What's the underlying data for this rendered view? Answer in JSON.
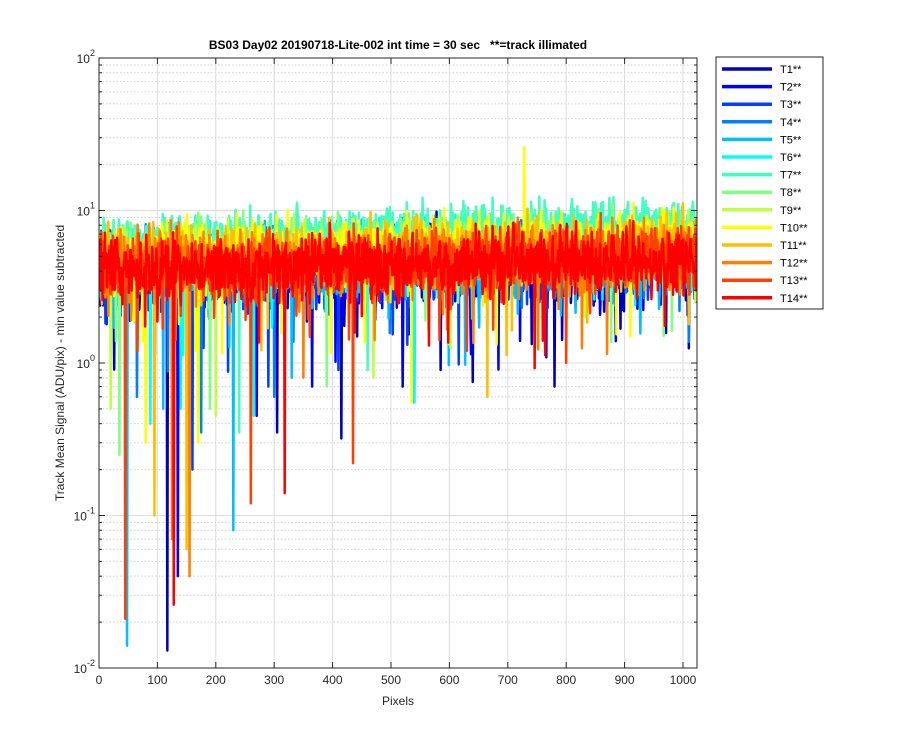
{
  "chart_data": {
    "type": "line",
    "title": "BS03 Day02 20190718-Lite-002 int time = 30 sec   **=track illimated",
    "xlabel": "Pixels",
    "ylabel": "Track Mean Signal (ADU/pix) - min value subtracted",
    "xlim": [
      0,
      1024
    ],
    "ylim": [
      0.01,
      100
    ],
    "yscale": "log",
    "grid": true,
    "legend_position": "outside-right",
    "x_ticks": [
      0,
      100,
      200,
      300,
      400,
      500,
      600,
      700,
      800,
      900,
      1000
    ],
    "y_ticks": [
      {
        "value": 0.01,
        "base": "10",
        "exp": "-2"
      },
      {
        "value": 0.1,
        "base": "10",
        "exp": "-1"
      },
      {
        "value": 1,
        "base": "10",
        "exp": "0"
      },
      {
        "value": 10,
        "base": "10",
        "exp": "1"
      },
      {
        "value": 100,
        "base": "10",
        "exp": "2"
      }
    ],
    "series": [
      {
        "name": "T1**",
        "color": "#0000bf",
        "level_start": 3.8,
        "level_end": 4.6,
        "noise": 0.28,
        "dips": [
          [
            117,
            0.013
          ],
          [
            305,
            0.35
          ],
          [
            415,
            0.32
          ],
          [
            520,
            0.7
          ],
          [
            585,
            0.9
          ],
          [
            640,
            0.75
          ],
          [
            780,
            0.7
          ]
        ]
      },
      {
        "name": "T2**",
        "color": "#0000ff",
        "level_start": 3.9,
        "level_end": 4.7,
        "noise": 0.27,
        "dips": [
          [
            135,
            0.04
          ],
          [
            270,
            0.45
          ],
          [
            365,
            0.7
          ],
          [
            520,
            0.8
          ]
        ]
      },
      {
        "name": "T3**",
        "color": "#0040ff",
        "level_start": 4.0,
        "level_end": 4.8,
        "noise": 0.26,
        "dips": [
          [
            160,
            0.2
          ],
          [
            290,
            0.7
          ],
          [
            410,
            0.9
          ]
        ]
      },
      {
        "name": "T4**",
        "color": "#0080ff",
        "level_start": 4.1,
        "level_end": 4.9,
        "noise": 0.26,
        "dips": [
          [
            65,
            0.6
          ],
          [
            175,
            0.35
          ],
          [
            300,
            0.6
          ],
          [
            540,
            0.55
          ]
        ]
      },
      {
        "name": "T5**",
        "color": "#00bfff",
        "level_start": 4.3,
        "level_end": 5.1,
        "noise": 0.25,
        "dips": [
          [
            48,
            0.014
          ],
          [
            110,
            0.5
          ],
          [
            230,
            0.08
          ],
          [
            330,
            0.8
          ]
        ]
      },
      {
        "name": "T6**",
        "color": "#00ffff",
        "level_start": 4.6,
        "level_end": 5.4,
        "noise": 0.25,
        "dips": [
          [
            88,
            0.4
          ],
          [
            140,
            0.5
          ],
          [
            265,
            0.45
          ],
          [
            540,
            0.55
          ]
        ]
      },
      {
        "name": "T7**",
        "color": "#40ffbf",
        "level_start": 6.3,
        "level_end": 8.5,
        "noise": 0.18,
        "dips": [
          [
            240,
            0.35
          ],
          [
            460,
            0.9
          ]
        ]
      },
      {
        "name": "T8**",
        "color": "#80ff80",
        "level_start": 5.0,
        "level_end": 6.2,
        "noise": 0.22,
        "dips": [
          [
            35,
            0.25
          ],
          [
            190,
            0.5
          ],
          [
            390,
            0.7
          ]
        ]
      },
      {
        "name": "T9**",
        "color": "#bfff40",
        "level_start": 4.8,
        "level_end": 6.0,
        "noise": 0.22,
        "dips": [
          [
            20,
            0.5
          ],
          [
            200,
            0.45
          ],
          [
            470,
            0.8
          ]
        ]
      },
      {
        "name": "T10**",
        "color": "#ffff00",
        "level_start": 4.9,
        "level_end": 6.2,
        "noise": 0.24,
        "dips": [
          [
            80,
            0.3
          ],
          [
            170,
            0.3
          ],
          [
            535,
            0.55
          ]
        ],
        "peaks": [
          [
            728,
            26
          ]
        ]
      },
      {
        "name": "T11**",
        "color": "#ffbf00",
        "level_start": 4.6,
        "level_end": 5.8,
        "noise": 0.24,
        "dips": [
          [
            95,
            0.1
          ],
          [
            150,
            0.06
          ],
          [
            665,
            0.6
          ]
        ]
      },
      {
        "name": "T12**",
        "color": "#ff8000",
        "level_start": 4.2,
        "level_end": 5.0,
        "noise": 0.24,
        "dips": [
          [
            125,
            0.07
          ],
          [
            155,
            0.04
          ],
          [
            350,
            0.8
          ]
        ]
      },
      {
        "name": "T13**",
        "color": "#ff4000",
        "level_start": 4.1,
        "level_end": 5.0,
        "noise": 0.24,
        "dips": [
          [
            45,
            0.021
          ],
          [
            260,
            0.12
          ],
          [
            435,
            0.22
          ],
          [
            630,
            1.2
          ],
          [
            800,
            1.0
          ]
        ]
      },
      {
        "name": "T14**",
        "color": "#ff0000",
        "level_start": 4.0,
        "level_end": 4.8,
        "noise": 0.23,
        "dips": [
          [
            128,
            0.026
          ],
          [
            318,
            0.14
          ],
          [
            565,
            1.3
          ],
          [
            760,
            1.4
          ]
        ]
      }
    ]
  }
}
